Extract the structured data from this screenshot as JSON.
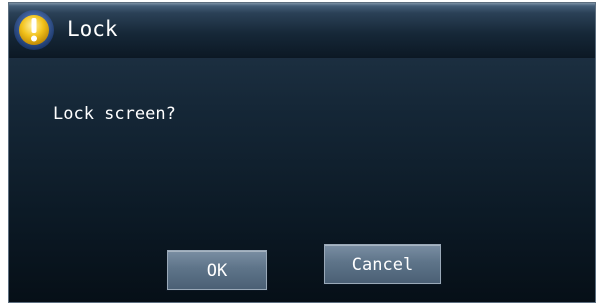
{
  "dialog": {
    "title": "Lock",
    "icon": "warning-icon",
    "message": "Lock screen?",
    "ok_label": "OK",
    "cancel_label": "Cancel"
  },
  "colors": {
    "icon_fill": "#f2c21b",
    "icon_ring": "#1e3a6e"
  }
}
